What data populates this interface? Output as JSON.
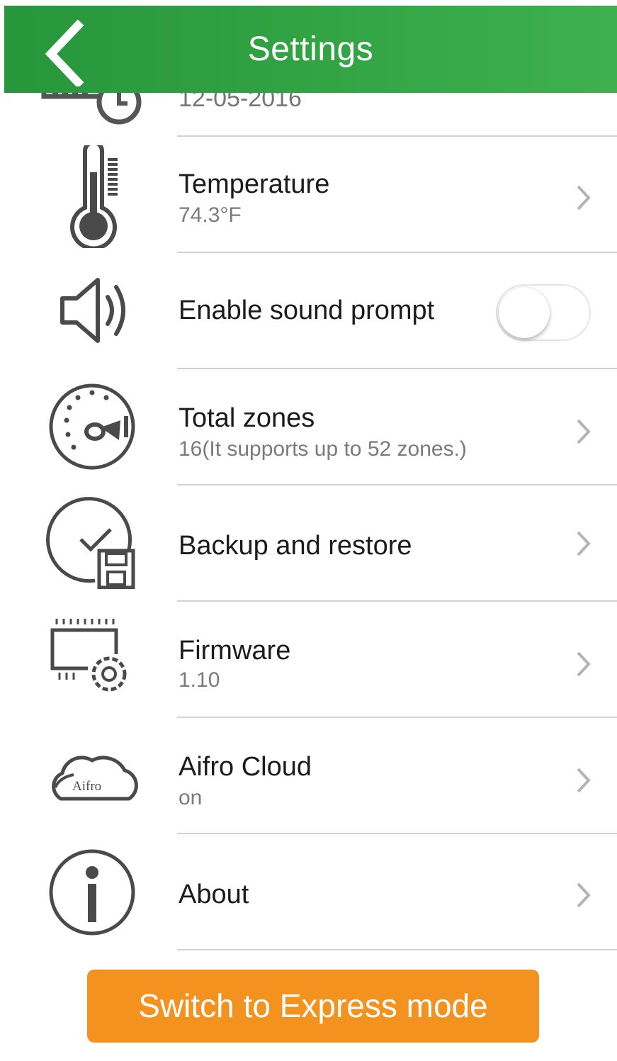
{
  "header": {
    "title": "Settings",
    "back_icon": "chevron-left-icon"
  },
  "rows": {
    "datetime": {
      "icon": "calendar-clock-icon",
      "value": "12-05-2016"
    },
    "temperature": {
      "icon": "thermometer-icon",
      "title": "Temperature",
      "value": "74.3°F"
    },
    "sound": {
      "icon": "speaker-icon",
      "title": "Enable sound prompt",
      "enabled": false
    },
    "zones": {
      "icon": "gauge-icon",
      "title": "Total zones",
      "value": "16(It supports up to 52 zones.)"
    },
    "backup": {
      "icon": "clock-check-save-icon",
      "title": "Backup and restore"
    },
    "firmware": {
      "icon": "chip-gear-icon",
      "title": "Firmware",
      "value": "1.10"
    },
    "cloud": {
      "icon": "cloud-icon",
      "title": "Aifro Cloud",
      "value": "on",
      "logo_text": "Aifro"
    },
    "about": {
      "icon": "info-icon",
      "title": "About"
    }
  },
  "express_button": {
    "label": "Switch to Express mode"
  },
  "colors": {
    "header_green": "#34a645",
    "button_orange": "#f4921f",
    "icon_gray": "#4a4a4a",
    "divider": "#d2d2d2"
  }
}
